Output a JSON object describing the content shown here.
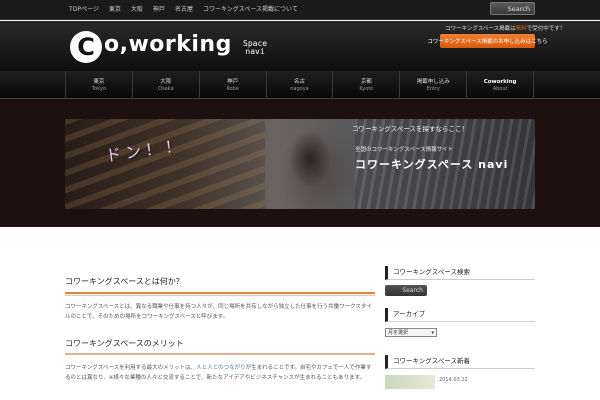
{
  "topbar": {
    "nav": [
      "TOPページ",
      "東京",
      "大阪",
      "神戸",
      "名古屋",
      "コワーキングスペース掲載について"
    ],
    "search_label": "Search"
  },
  "header": {
    "logo_c": "C",
    "logo_text": "o,working",
    "logo_sub_1": "Space",
    "logo_sub_2": "navi",
    "note_prefix": "コワーキングスペース掲載は",
    "note_highlight": "無料",
    "note_suffix": "で受付中です！",
    "cta_label": "コワーキングスペース掲載のお申し込みはこちら"
  },
  "gnav": [
    {
      "ja": "東京",
      "en": "Tokyo"
    },
    {
      "ja": "大阪",
      "en": "Osaka"
    },
    {
      "ja": "神戸",
      "en": "Kobe"
    },
    {
      "ja": "名古",
      "en": "nagoya"
    },
    {
      "ja": "京都",
      "en": "Kyoto"
    },
    {
      "ja": "掲載申し込み",
      "en": "Entry"
    },
    {
      "ja": "Coworking",
      "en": "About"
    }
  ],
  "hero": {
    "don": "ドン！！",
    "caption_1": "コワーキングスペースを探すならここ！",
    "caption_2": "全国のコワーキングスペース情報サイト",
    "title": "コワーキングスペース navi"
  },
  "main": {
    "h1": "コワーキングスペースとは何か？",
    "p1": "コワーキングスペースとは、異なる職業や仕事を持つ人々が、同じ場所を共有しながら独立した仕事を行う共働ワークスタイルのことで、そのための場所をコワーキングスペースと呼びます。",
    "h2": "コワーキングスペースのメリット",
    "p2_a": "コワーキングスペースを利用する最大のメリットは、",
    "p2_link": "人と人とのつながり",
    "p2_b": "が生まれることです。自宅やカフェで一人で作業するのとは異なり、※様々な業種の人々と交流することで、新たなアイデアやビジネスチャンスが生まれることもあります。"
  },
  "sidebar": {
    "h_search": "コワーキングスペース検索",
    "search_label": "Search",
    "h_archive": "アーカイブ",
    "select_value": "月を選択",
    "h_recent": "コワーキングスペース新着",
    "recent_date": "2014.03.22"
  }
}
